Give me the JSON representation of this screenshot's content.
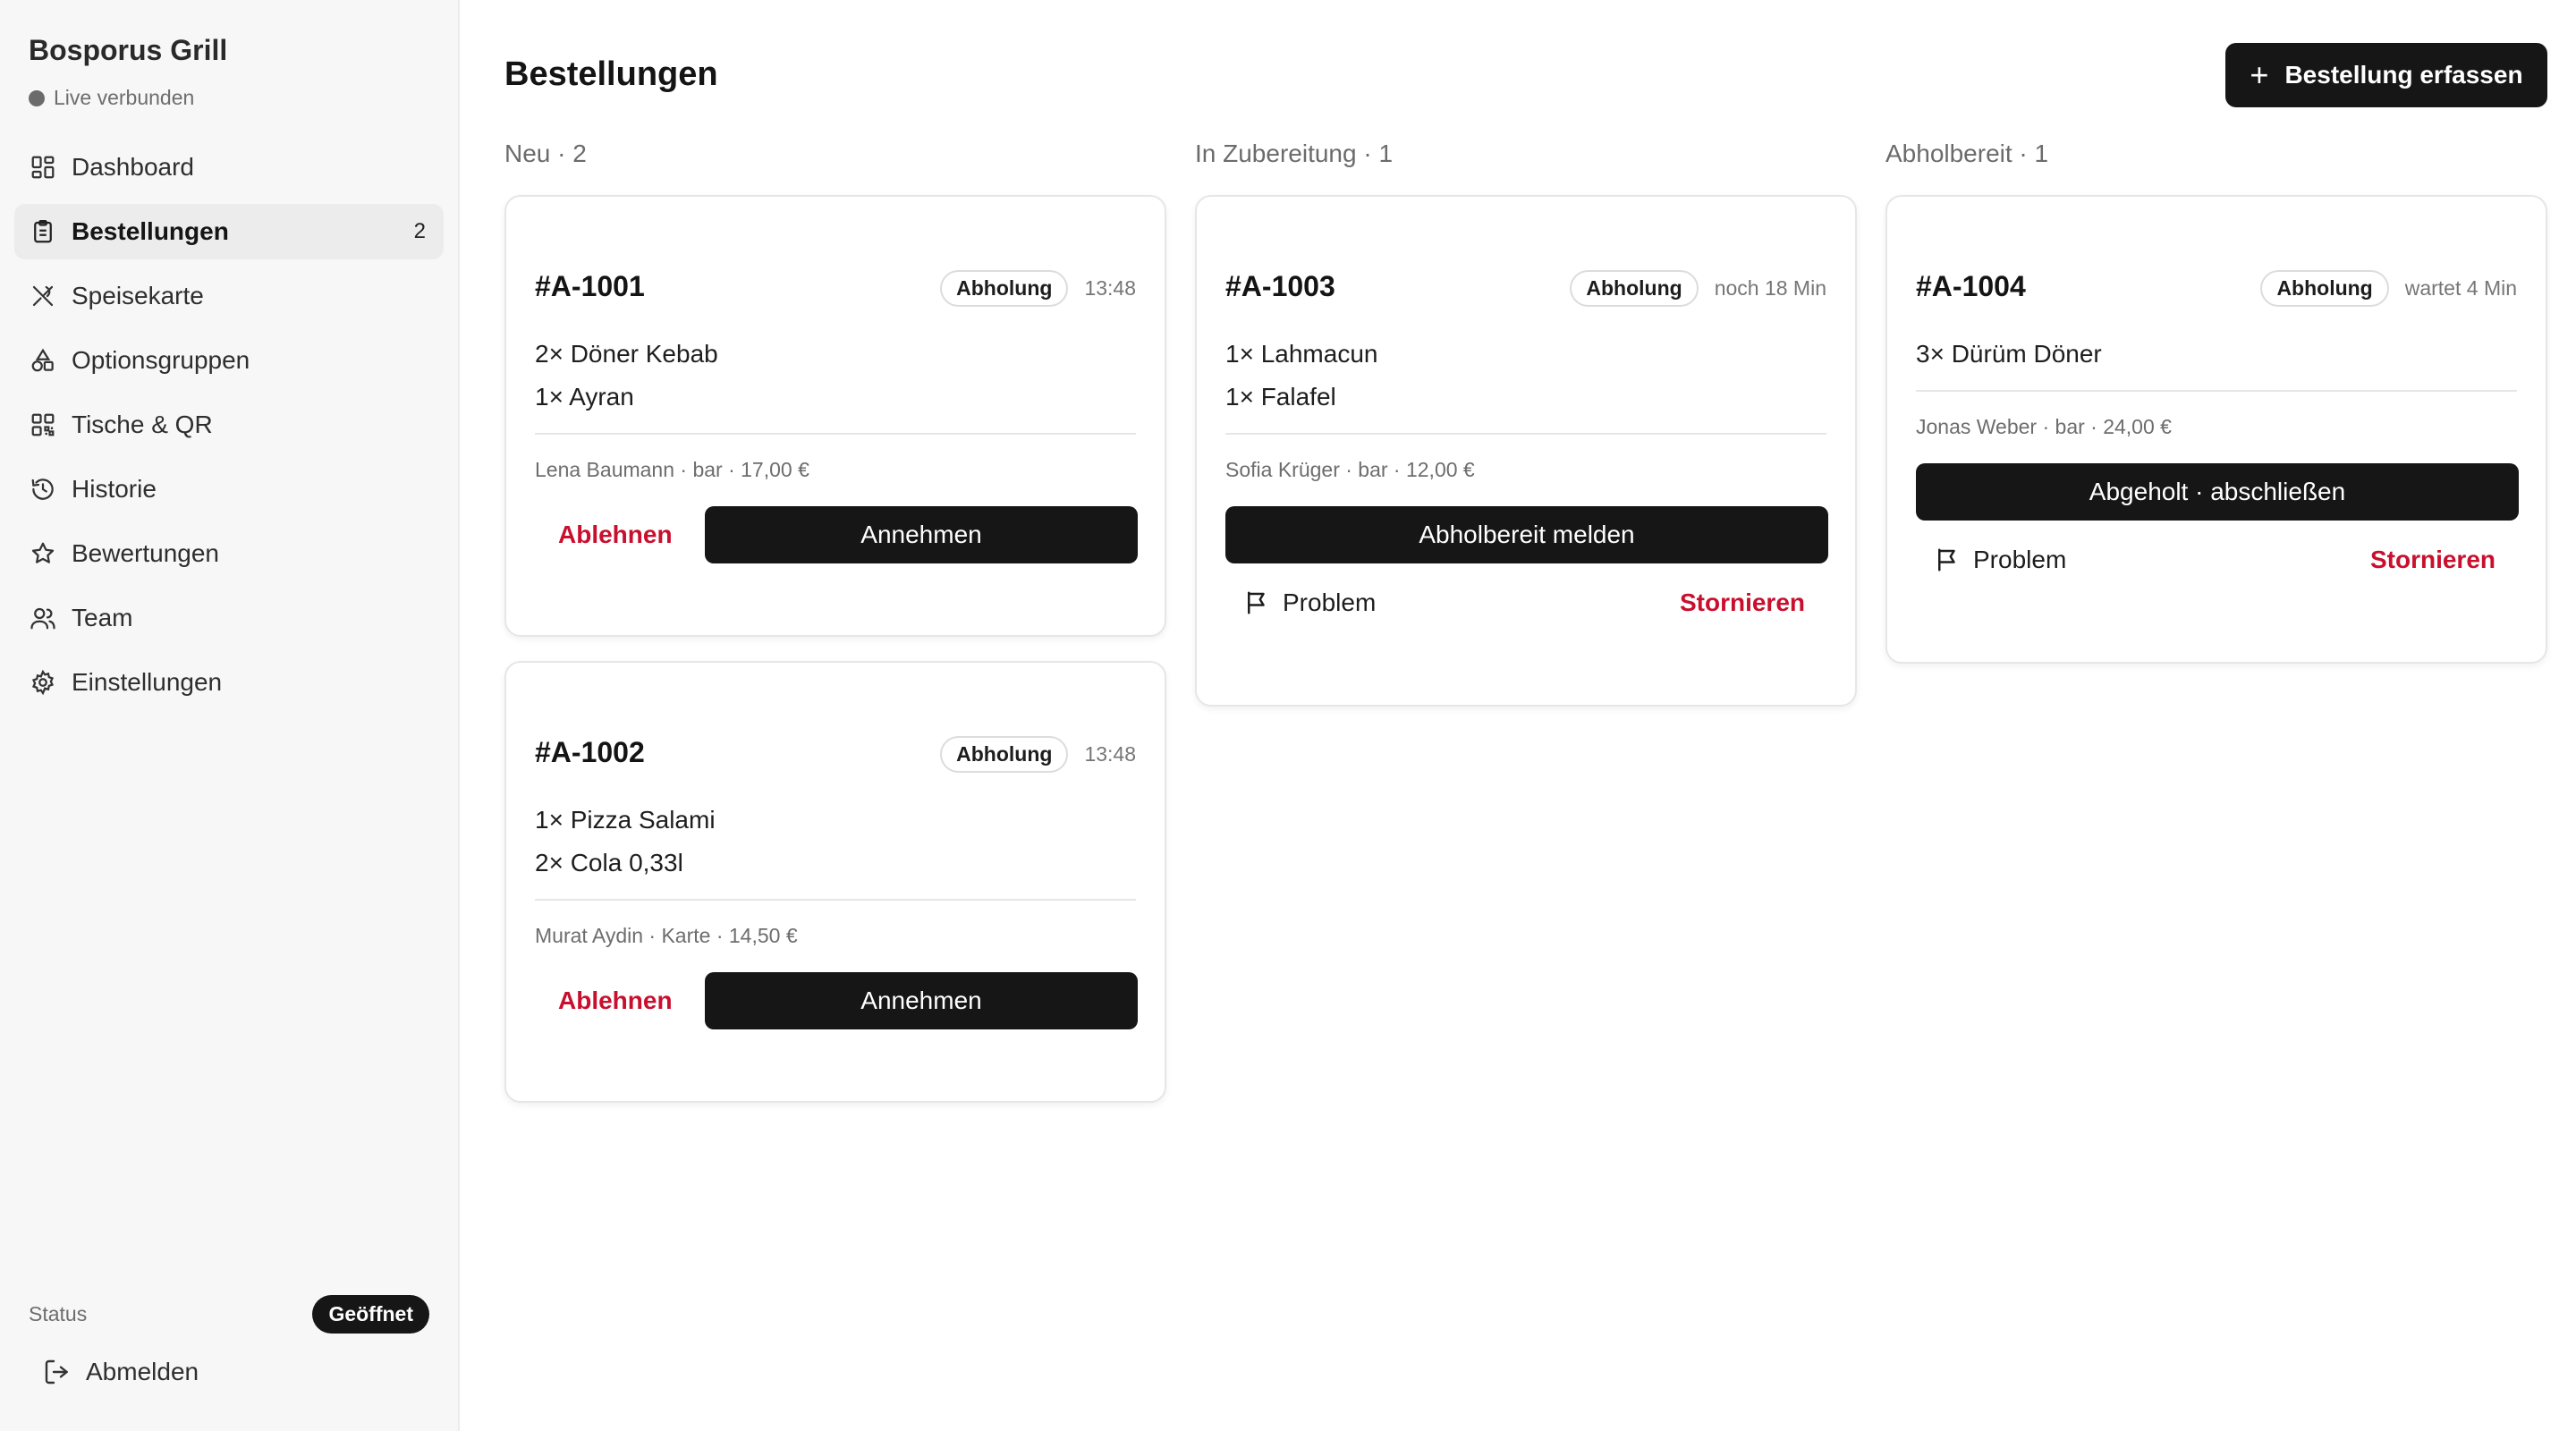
{
  "sidebar": {
    "brand": "Bosporus Grill",
    "live_status": "Live verbunden",
    "items": [
      {
        "label": "Dashboard",
        "icon": "dashboard-icon"
      },
      {
        "label": "Bestellungen",
        "icon": "clipboard-icon",
        "count": "2",
        "active": true
      },
      {
        "label": "Speisekarte",
        "icon": "utensils-icon"
      },
      {
        "label": "Optionsgruppen",
        "icon": "shapes-icon"
      },
      {
        "label": "Tische & QR",
        "icon": "qr-code-icon"
      },
      {
        "label": "Historie",
        "icon": "history-icon"
      },
      {
        "label": "Bewertungen",
        "icon": "star-icon"
      },
      {
        "label": "Team",
        "icon": "users-icon"
      },
      {
        "label": "Einstellungen",
        "icon": "gear-icon"
      }
    ],
    "status_label": "Status",
    "status_value": "Geöffnet",
    "logout_label": "Abmelden"
  },
  "header": {
    "title": "Bestellungen",
    "new_order_label": "Bestellung erfassen"
  },
  "columns": [
    {
      "title": "Neu · 2"
    },
    {
      "title": "In Zubereitung · 1"
    },
    {
      "title": "Abholbereit · 1"
    }
  ],
  "orders": {
    "a1001": {
      "id": "#A-1001",
      "type": "Abholung",
      "time": "13:48",
      "items": [
        "2× Döner Kebab",
        "1× Ayran"
      ],
      "customer": "Lena Baumann · bar · 17,00 €",
      "reject": "Ablehnen",
      "accept": "Annehmen"
    },
    "a1002": {
      "id": "#A-1002",
      "type": "Abholung",
      "time": "13:48",
      "items": [
        "1× Pizza Salami",
        "2× Cola 0,33l"
      ],
      "customer": "Murat Aydin · Karte · 14,50 €",
      "reject": "Ablehnen",
      "accept": "Annehmen"
    },
    "a1003": {
      "id": "#A-1003",
      "type": "Abholung",
      "time": "noch 18 Min",
      "items": [
        "1× Lahmacun",
        "1× Falafel"
      ],
      "customer": "Sofia Krüger · bar · 12,00 €",
      "primary": "Abholbereit melden",
      "problem": "Problem",
      "cancel": "Stornieren"
    },
    "a1004": {
      "id": "#A-1004",
      "type": "Abholung",
      "time": "wartet 4 Min",
      "items": [
        "3× Dürüm Döner"
      ],
      "customer": "Jonas Weber · bar · 24,00 €",
      "primary": "Abgeholt · abschließen",
      "problem": "Problem",
      "cancel": "Stornieren"
    }
  },
  "colors": {
    "dark": "#161616",
    "danger": "#c8102e",
    "sidebar_bg": "#f7f7f7"
  }
}
